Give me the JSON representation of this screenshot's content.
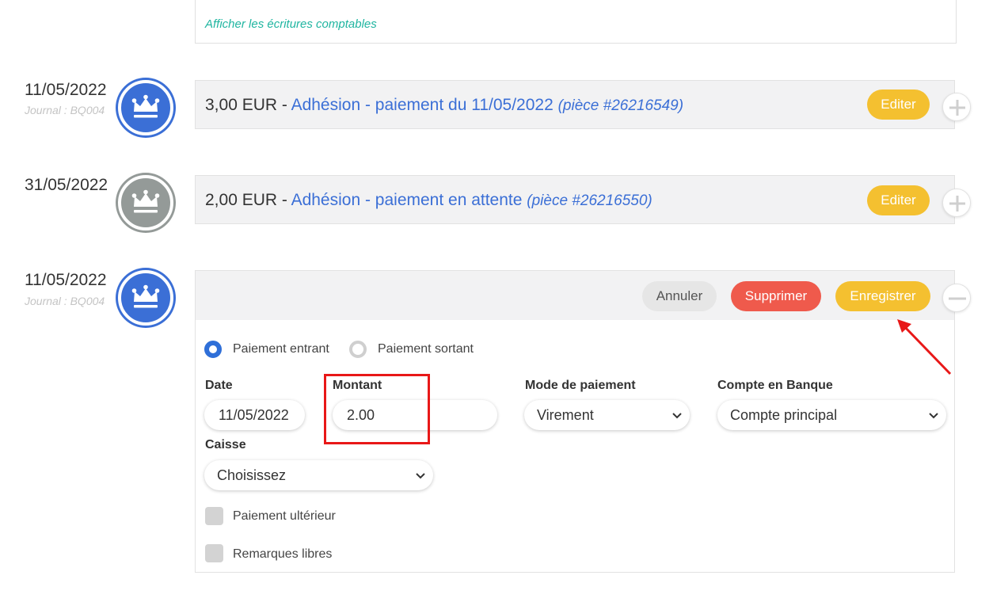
{
  "top_card": {
    "link": "Afficher les écritures comptables"
  },
  "entries": [
    {
      "date": "11/05/2022",
      "journal": "Journal : BQ004",
      "avatar_color": "#3b6fd6",
      "amount": "3,00 EUR",
      "separator": " - ",
      "title": "Adhésion - paiement du 11/05/2022",
      "piece": "(pièce #26216549)",
      "edit_label": "Editer",
      "toggle_icon": "plus-icon"
    },
    {
      "date": "31/05/2022",
      "journal": "",
      "avatar_color": "#949a98",
      "amount": "2,00 EUR",
      "separator": " - ",
      "title": "Adhésion - paiement en attente",
      "piece": "(pièce #26216550)",
      "edit_label": "Editer",
      "toggle_icon": "plus-icon"
    },
    {
      "date": "11/05/2022",
      "journal": "Journal : BQ004",
      "avatar_color": "#3b6fd6",
      "cancel_label": "Annuler",
      "delete_label": "Supprimer",
      "save_label": "Enregistrer",
      "toggle_icon": "minus-icon"
    }
  ],
  "form": {
    "radio_in": "Paiement entrant",
    "radio_out": "Paiement sortant",
    "selected_radio": "Paiement entrant",
    "date_label": "Date",
    "date_value": "11/05/2022",
    "amount_label": "Montant",
    "amount_value": "2.00",
    "payment_mode_label": "Mode de paiement",
    "payment_mode_value": "Virement",
    "bank_account_label": "Compte en Banque",
    "bank_account_value": "Compte principal",
    "cash_label": "Caisse",
    "cash_value": "Choisissez",
    "deferred_label": "Paiement ultérieur",
    "remarks_label": "Remarques libres"
  },
  "colors": {
    "blue": "#3b6fd6",
    "teal_link": "#1fb5a0",
    "yellow": "#f4c030",
    "red": "#ef5a4c",
    "annotation_red": "#e81818"
  }
}
